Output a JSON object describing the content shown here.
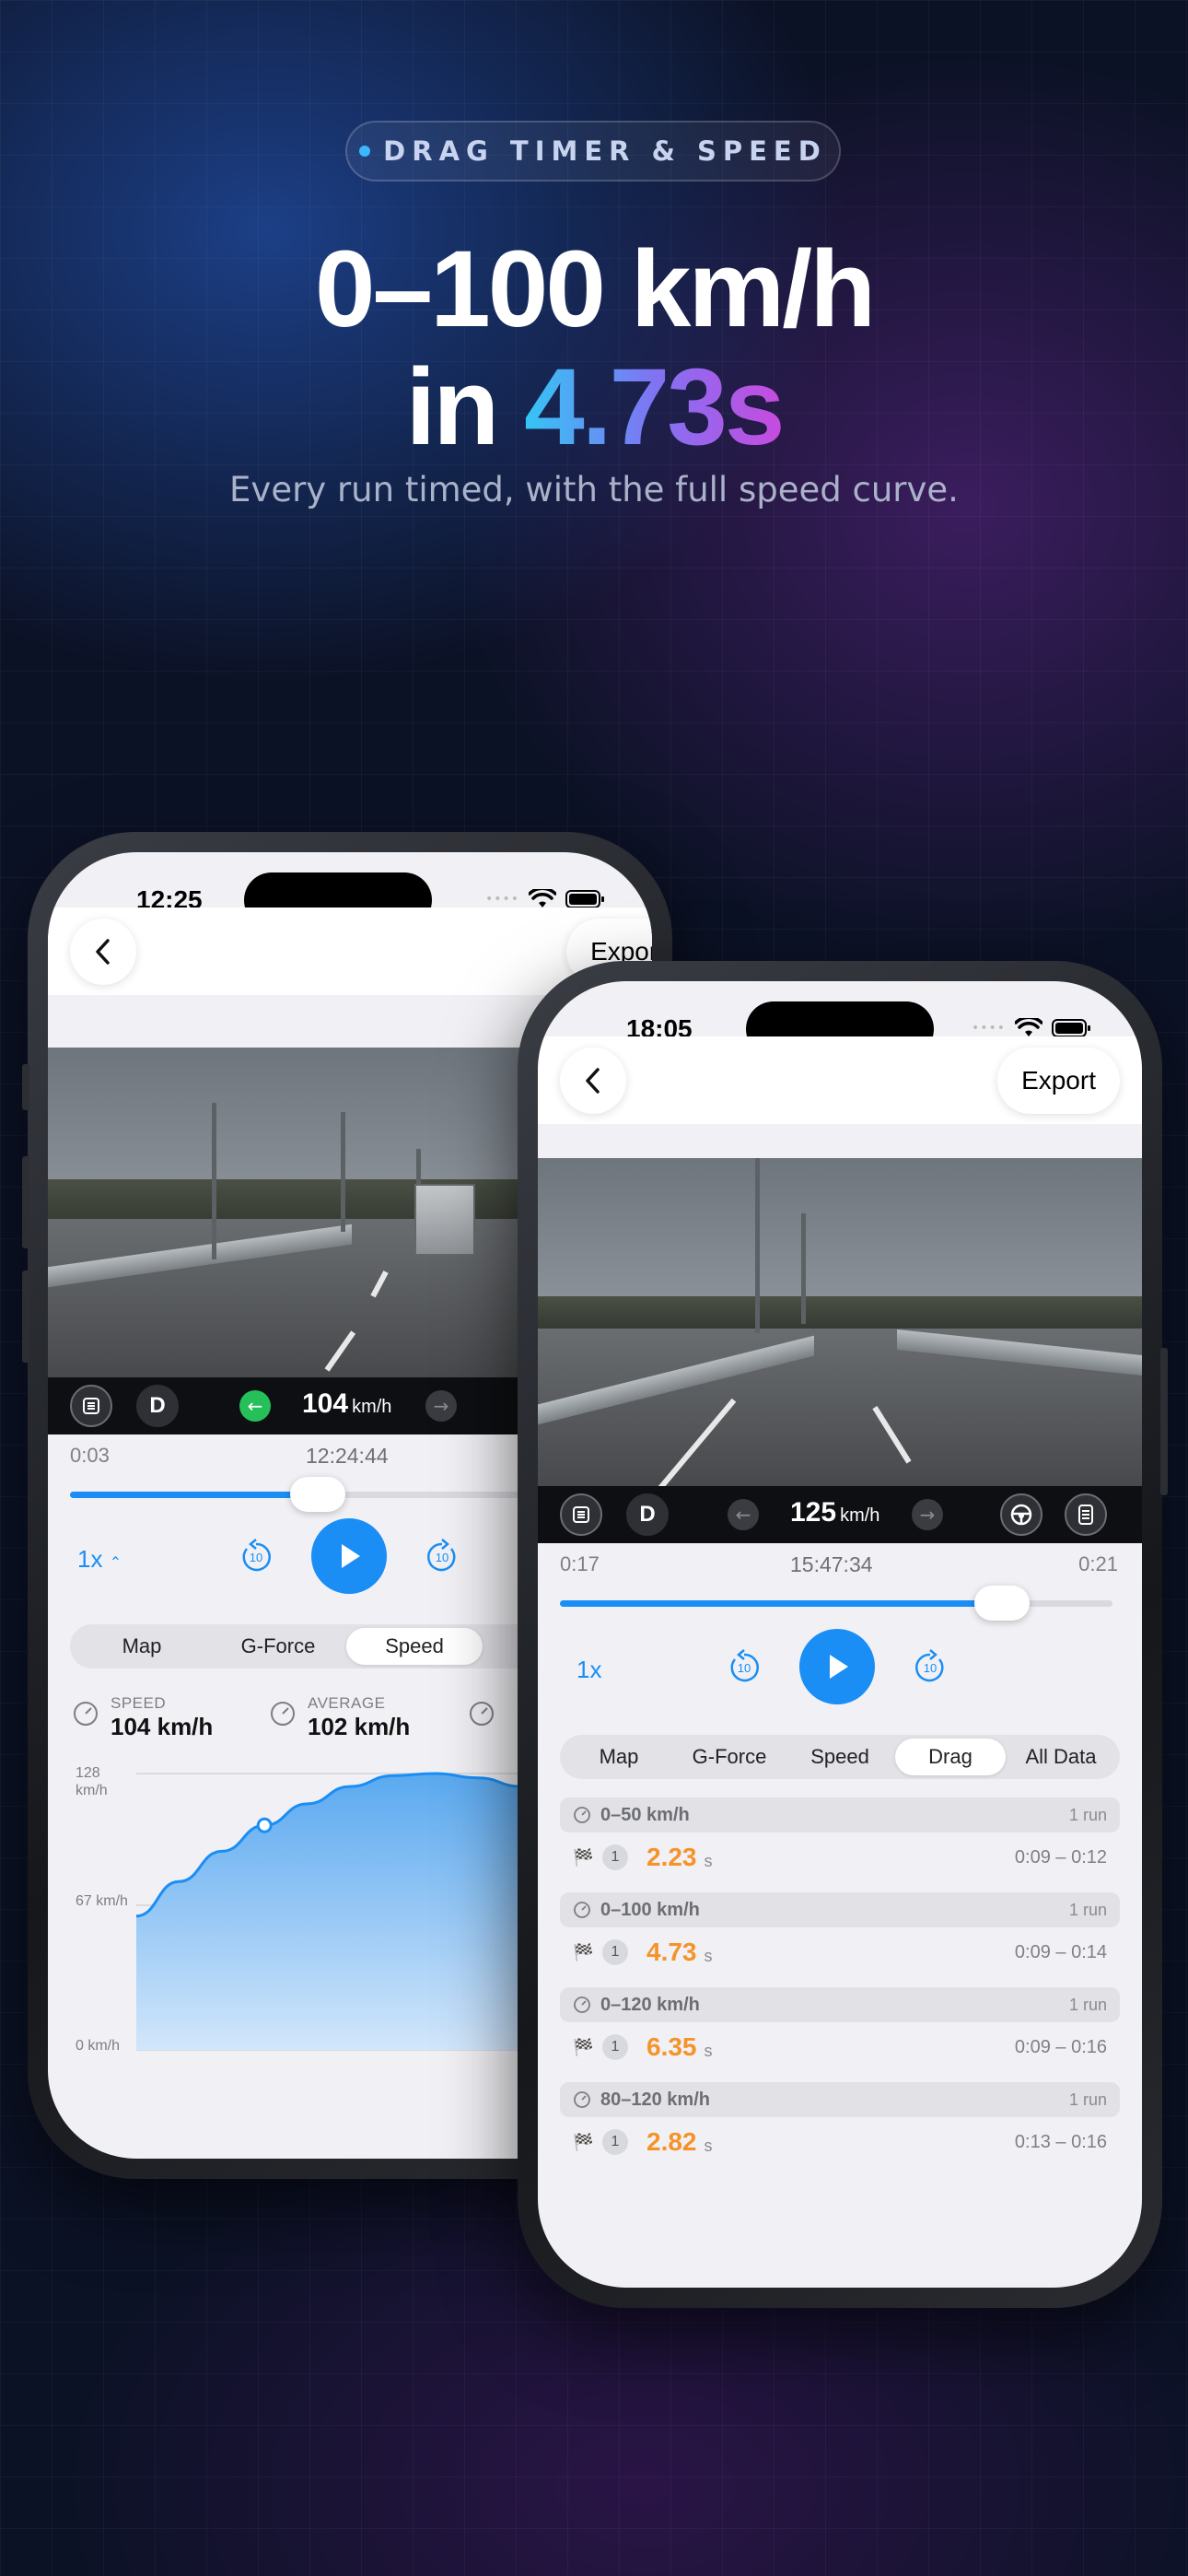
{
  "badge": {
    "label": "DRAG TIMER & SPEED"
  },
  "headline": {
    "line1": "0–100 km/h",
    "line2_prefix": "in ",
    "line2_accent": "4.73s"
  },
  "subtitle": "Every run timed, with the full speed curve.",
  "colors": {
    "accent_blue": "#1a8ef5",
    "orange": "#f5932a",
    "background": "#0c1226"
  },
  "phone_back": {
    "status_time": "12:25",
    "export_label": "Export",
    "gear": "D",
    "speed_value": "104",
    "speed_unit": "km/h",
    "timeline": {
      "left": "0:03",
      "center": "12:24:44",
      "progress": 0.42
    },
    "rate": "1x",
    "skip_seconds": "10",
    "tabs": [
      "Map",
      "G-Force",
      "Speed",
      "Drag"
    ],
    "active_tab": "Speed",
    "stats": [
      {
        "label": "SPEED",
        "value": "104 km/h"
      },
      {
        "label": "AVERAGE",
        "value": "102 km/h"
      }
    ],
    "chart_data": {
      "type": "area",
      "title": "",
      "xlabel": "",
      "ylabel": "km/h",
      "ylim": [
        0,
        128
      ],
      "y_ticks": [
        "0 km/h",
        "67 km/h",
        "128 km/h"
      ],
      "grid": true,
      "series": [
        {
          "values": [
            62,
            78,
            92,
            104,
            114,
            122,
            127,
            128,
            126,
            122,
            118
          ]
        }
      ],
      "marker_index": 3
    }
  },
  "phone_front": {
    "status_time": "18:05",
    "export_label": "Export",
    "gear": "D",
    "speed_value": "125",
    "speed_unit": "km/h",
    "timeline": {
      "left": "0:17",
      "center": "15:47:34",
      "right": "0:21",
      "progress": 0.8
    },
    "rate": "1x",
    "skip_seconds": "10",
    "tabs": [
      "Map",
      "G-Force",
      "Speed",
      "Drag",
      "All Data"
    ],
    "active_tab": "Drag",
    "runs": [
      {
        "title": "0–50 km/h",
        "count": "1 run",
        "rank": "1",
        "time": "2.23",
        "unit": "s",
        "range": "0:09 – 0:12"
      },
      {
        "title": "0–100 km/h",
        "count": "1 run",
        "rank": "1",
        "time": "4.73",
        "unit": "s",
        "range": "0:09 – 0:14"
      },
      {
        "title": "0–120 km/h",
        "count": "1 run",
        "rank": "1",
        "time": "6.35",
        "unit": "s",
        "range": "0:09 – 0:16"
      },
      {
        "title": "80–120 km/h",
        "count": "1 run",
        "rank": "1",
        "time": "2.82",
        "unit": "s",
        "range": "0:13 – 0:16"
      }
    ]
  }
}
